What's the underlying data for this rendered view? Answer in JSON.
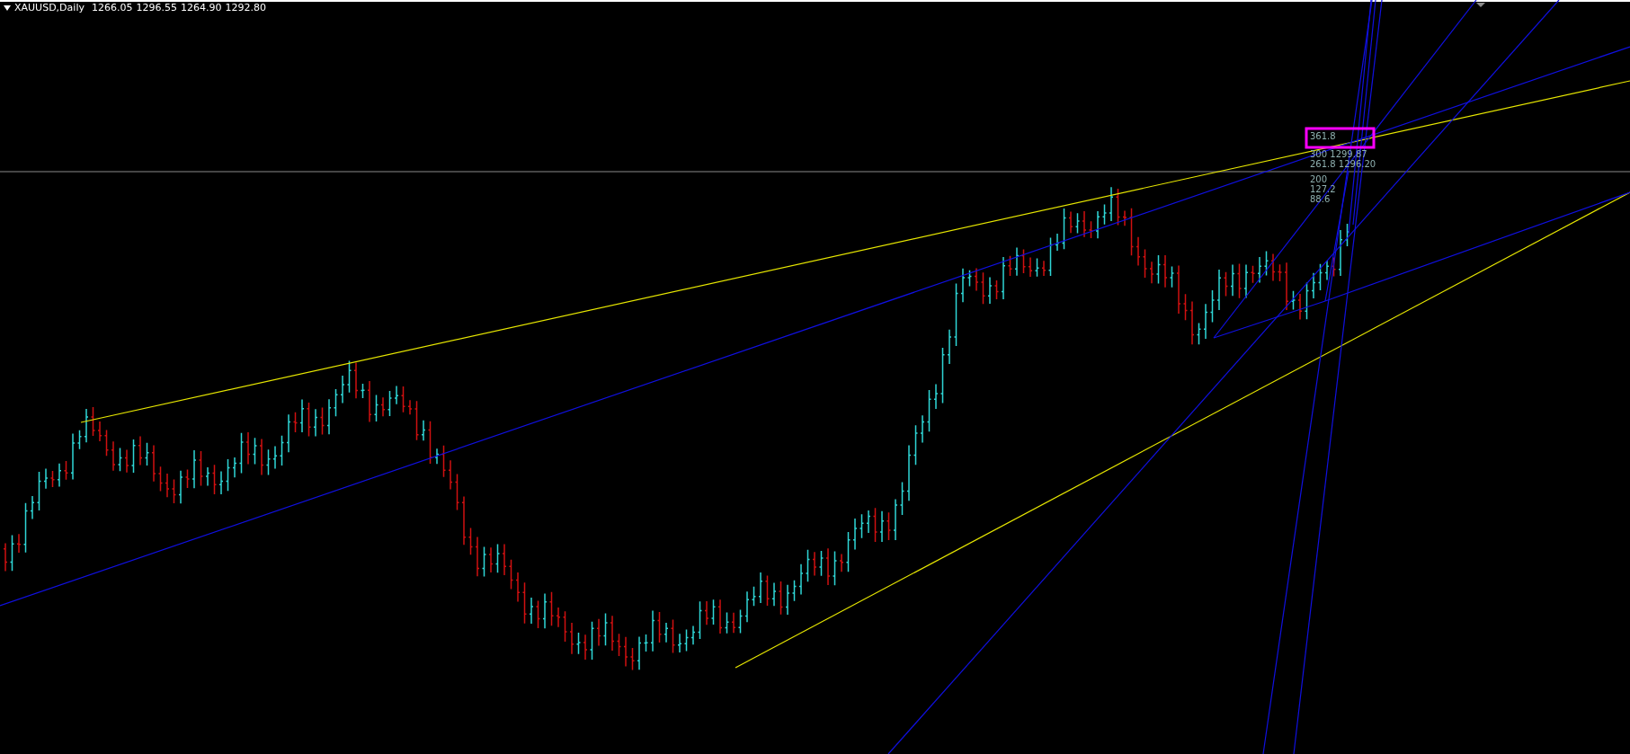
{
  "chart_header": {
    "symbol": "XAUUSD,Daily",
    "ohlc": [
      "1266.05",
      "1296.55",
      "1264.90",
      "1292.80"
    ]
  },
  "fib_labels": [
    {
      "level": "361.8"
    },
    {
      "level": "300",
      "price": "1299.87"
    },
    {
      "level": "261.8",
      "price": "1296.20"
    },
    {
      "level": "200"
    },
    {
      "level": "127.2"
    },
    {
      "level": "88.6"
    }
  ]
}
